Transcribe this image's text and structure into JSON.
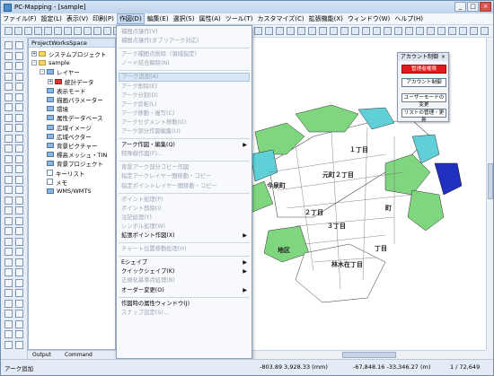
{
  "window": {
    "title": "PC-Mapping - [sample]",
    "minimize_glyph": "_",
    "maximize_glyph": "□",
    "close_glyph": "×"
  },
  "menubar": {
    "items": [
      "ファイル(F)",
      "設定(L)",
      "表示(V)",
      "印刷(P)",
      "作図(D)",
      "編集(E)",
      "選択(S)",
      "属性(A)",
      "ツール(T)",
      "カスタマイズ(C)",
      "拡張機能(X)",
      "ウィンドウ(W)",
      "ヘルプ(H)"
    ],
    "active_index": 4
  },
  "panel": {
    "header": "ProjectWorksSpace",
    "tree": [
      {
        "label": "システムプロジェクト",
        "indent": 0,
        "icon": "folder",
        "expander": "+"
      },
      {
        "label": "sample",
        "indent": 0,
        "icon": "folder",
        "expander": "-"
      },
      {
        "label": "レイヤー",
        "indent": 1,
        "icon": "folder-blue",
        "expander": "-"
      },
      {
        "label": "統計データ",
        "indent": 2,
        "icon": "layer-red",
        "expander": "+"
      },
      {
        "label": "表示モード",
        "indent": 1,
        "icon": "folder-blue",
        "expander": ""
      },
      {
        "label": "描画パラメーター",
        "indent": 1,
        "icon": "folder-blue",
        "expander": ""
      },
      {
        "label": "環境",
        "indent": 1,
        "icon": "folder-blue",
        "expander": ""
      },
      {
        "label": "属性データベース",
        "indent": 1,
        "icon": "folder-blue",
        "expander": ""
      },
      {
        "label": "広域イメージ",
        "indent": 1,
        "icon": "folder-blue",
        "expander": ""
      },
      {
        "label": "広域ベクター",
        "indent": 1,
        "icon": "folder-blue",
        "expander": ""
      },
      {
        "label": "背景ピクチャー",
        "indent": 1,
        "icon": "folder-blue",
        "expander": ""
      },
      {
        "label": "標高メッシュ・TIN",
        "indent": 1,
        "icon": "folder-blue",
        "expander": ""
      },
      {
        "label": "背景プロジェクト",
        "indent": 1,
        "icon": "folder-blue",
        "expander": ""
      },
      {
        "label": "キーリスト",
        "indent": 1,
        "icon": "leaf",
        "expander": ""
      },
      {
        "label": "メモ",
        "indent": 1,
        "icon": "leaf",
        "expander": ""
      },
      {
        "label": "WMS/WMTS",
        "indent": 1,
        "icon": "folder-blue",
        "expander": ""
      }
    ],
    "tabs": [
      "Output",
      "Command"
    ]
  },
  "dropdown": {
    "items": [
      {
        "label": "補間点操作(V)",
        "disabled": true,
        "arrow": false
      },
      {
        "label": "補間点操作(ダブリアーク対応)",
        "disabled": true,
        "arrow": false
      },
      {
        "sep": true
      },
      {
        "label": "アーク補間点削除（領域指定）",
        "disabled": true,
        "arrow": false
      },
      {
        "label": "ノード結合解除(N)",
        "disabled": true,
        "arrow": false
      },
      {
        "sep": true
      },
      {
        "label": "アーク追加(A)",
        "disabled": true,
        "arrow": false,
        "hl": true
      },
      {
        "label": "アーク削除(E)",
        "disabled": true,
        "arrow": false
      },
      {
        "label": "アーク分割(D)",
        "disabled": true,
        "arrow": false
      },
      {
        "label": "アーク反転(L)",
        "disabled": true,
        "arrow": false
      },
      {
        "label": "アーク移動・複写(C)",
        "disabled": true,
        "arrow": false
      },
      {
        "label": "アークセグメント移動(G)",
        "disabled": true,
        "arrow": false
      },
      {
        "label": "アーク部分作図編集(U)",
        "disabled": true,
        "arrow": false
      },
      {
        "sep": true
      },
      {
        "label": "アーク作図・編集(Q)",
        "disabled": false,
        "arrow": true
      },
      {
        "label": "特殊線作図(F)...",
        "disabled": true,
        "arrow": false
      },
      {
        "sep": true
      },
      {
        "label": "背景アーク部分コピー作図",
        "disabled": true,
        "arrow": false
      },
      {
        "label": "指定アークレイヤー間移動・コピー",
        "disabled": true,
        "arrow": false
      },
      {
        "label": "指定ポイントレイヤー間移動・コピー",
        "disabled": true,
        "arrow": false
      },
      {
        "sep": true
      },
      {
        "label": "ポイント処理(P)",
        "disabled": true,
        "arrow": false
      },
      {
        "label": "ポイント削除(I)",
        "disabled": true,
        "arrow": false
      },
      {
        "label": "注記処理(Y)",
        "disabled": true,
        "arrow": false
      },
      {
        "label": "シンボル処理(W)",
        "disabled": true,
        "arrow": false
      },
      {
        "label": "拡張ポイント作図(X)",
        "disabled": false,
        "arrow": true
      },
      {
        "sep": true
      },
      {
        "label": "チャート位置移動処理(H)",
        "disabled": true,
        "arrow": false
      },
      {
        "sep": true
      },
      {
        "label": "Eシェイプ",
        "disabled": false,
        "arrow": true
      },
      {
        "label": "クイックシェイプ(K)",
        "disabled": false,
        "arrow": true
      },
      {
        "label": "正規化基準点処理(B)",
        "disabled": true,
        "arrow": false
      },
      {
        "label": "オーダー変更(O)",
        "disabled": false,
        "arrow": true
      },
      {
        "sep": true
      },
      {
        "label": "作図時の属性ウィンドウ(J)",
        "disabled": false,
        "arrow": false
      },
      {
        "label": "スナップ設定(S)...",
        "disabled": true,
        "arrow": false
      }
    ]
  },
  "account_panel": {
    "title": "アカウント制御",
    "close_glyph": "×",
    "buttons": [
      "管理者権限",
      "アカウント制御",
      "ユーザーモードの変更",
      "リストの管理・更新"
    ]
  },
  "map": {
    "labels": [
      "今泉町",
      "元町２丁目",
      "１丁目",
      "２丁目",
      "３丁目",
      "丁目",
      "林木在丁目",
      "地区",
      "町"
    ]
  },
  "statusbar": {
    "left": "アーク追加",
    "coord1": "-803.89 3,928.33 (mm)",
    "coord2": "-67,848.16 -33,346.27 (m)",
    "page": "1 / 72,649"
  },
  "colors": {
    "accent": "#3a6fc4",
    "map_green": "#7fd67f",
    "map_cyan": "#5fd0d8",
    "map_blue": "#2030c0",
    "red_button": "#e01a1a"
  }
}
